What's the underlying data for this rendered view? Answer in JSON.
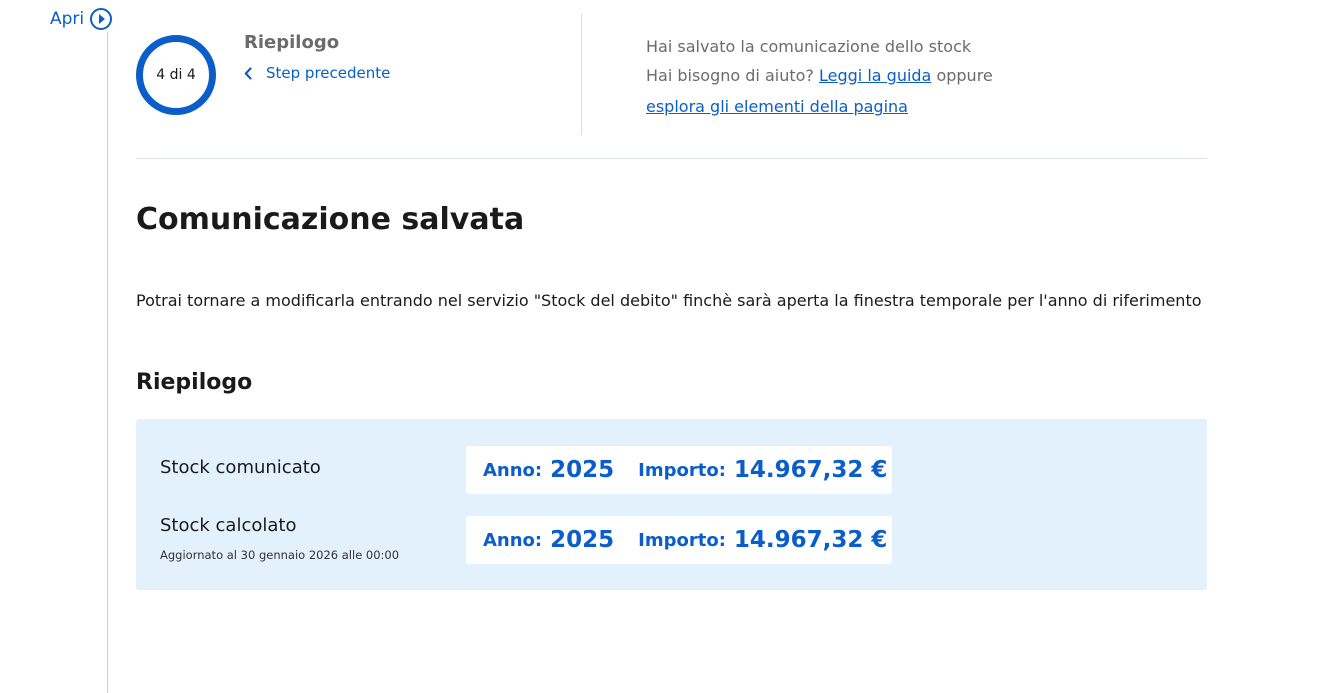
{
  "rail": {
    "open_label": "Apri",
    "icon": "play-circle-icon"
  },
  "stepper": {
    "progress_label": "4 di 4",
    "current": 4,
    "total": 4,
    "title": "Riepilogo",
    "back_label": "Step precedente",
    "back_icon": "chevron-left-icon"
  },
  "help": {
    "status_text": "Hai salvato la comunicazione dello stock",
    "question_text": "Hai bisogno di aiuto?",
    "guide_link": "Leggi la guida",
    "or_text": "oppure",
    "explore_link": "esplora gli elementi della pagina"
  },
  "main": {
    "title": "Comunicazione salvata",
    "description": "Potrai tornare a modificarla entrando nel servizio \"Stock del debito\" finchè sarà aperta la finestra temporale per l'anno di riferimento",
    "summary_title": "Riepilogo"
  },
  "summary": {
    "rows": [
      {
        "label": "Stock comunicato",
        "note": "",
        "year_key": "Anno:",
        "year_value": "2025",
        "amount_key": "Importo:",
        "amount_value": "14.967,32 €"
      },
      {
        "label": "Stock calcolato",
        "note": "Aggiornato al 30 gennaio 2026 alle 00:00",
        "year_key": "Anno:",
        "year_value": "2025",
        "amount_key": "Importo:",
        "amount_value": "14.967,32 €"
      }
    ]
  },
  "colors": {
    "accent": "#0b5ec9",
    "summary_bg": "#e3f1fd",
    "muted_text": "#6b6b6b",
    "divider": "#dadfe5"
  }
}
